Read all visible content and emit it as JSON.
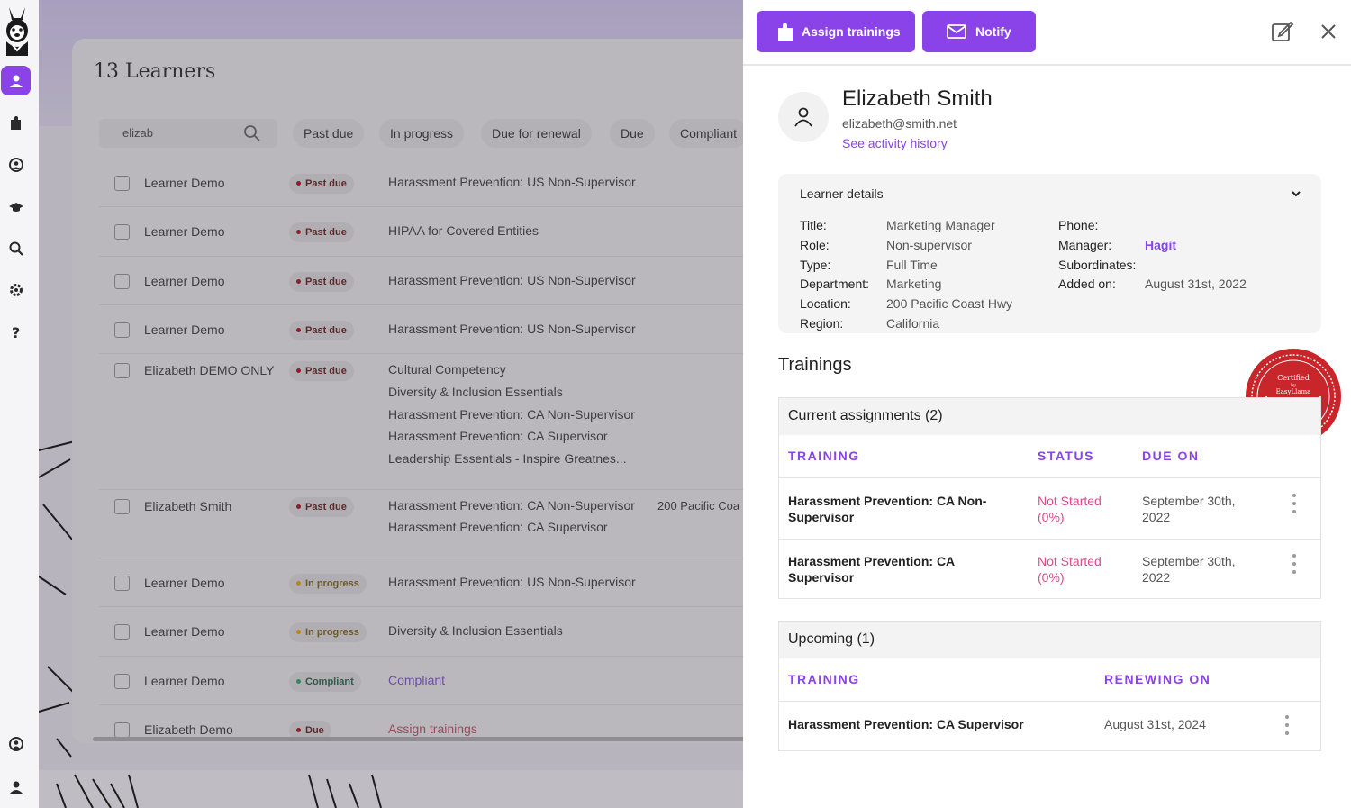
{
  "sidebar": {
    "items": [
      {
        "icon": "user-icon",
        "active": true
      },
      {
        "icon": "puzzle-icon"
      },
      {
        "icon": "face-icon"
      },
      {
        "icon": "graduation-cap-icon"
      },
      {
        "icon": "search-icon"
      },
      {
        "icon": "gear-icon"
      },
      {
        "icon": "help-icon"
      },
      {
        "icon": "face-icon"
      },
      {
        "icon": "user-icon"
      }
    ]
  },
  "learners": {
    "title": "13 Learners",
    "search_value": "elizab",
    "filters": [
      "Past due",
      "In progress",
      "Due for renewal",
      "Due",
      "Compliant"
    ],
    "rows": [
      {
        "name": "Learner Demo",
        "status": "Past due",
        "courses": [
          "Harassment Prevention: US Non-Supervisor"
        ]
      },
      {
        "name": "Learner Demo",
        "status": "Past due",
        "courses": [
          "HIPAA for Covered Entities"
        ]
      },
      {
        "name": "Learner Demo",
        "status": "Past due",
        "courses": [
          "Harassment Prevention: US Non-Supervisor"
        ]
      },
      {
        "name": "Learner Demo",
        "status": "Past due",
        "courses": [
          "Harassment Prevention: US Non-Supervisor"
        ]
      },
      {
        "name": "Elizabeth DEMO ONLY",
        "status": "Past due",
        "courses": [
          "Cultural Competency",
          "Diversity & Inclusion Essentials",
          "Harassment Prevention: CA Non-Supervisor",
          "Harassment Prevention: CA Supervisor",
          "Leadership Essentials - Inspire Greatnes..."
        ]
      },
      {
        "name": "Elizabeth Smith",
        "status": "Past due",
        "courses": [
          "Harassment Prevention: CA Non-Supervisor",
          "Harassment Prevention: CA Supervisor"
        ],
        "location": "200 Pacific Coa"
      },
      {
        "name": "Learner Demo",
        "status": "In progress",
        "courses": [
          "Harassment Prevention: US Non-Supervisor"
        ]
      },
      {
        "name": "Learner Demo",
        "status": "In progress",
        "courses": [
          "Diversity & Inclusion Essentials"
        ]
      },
      {
        "name": "Learner Demo",
        "status": "Compliant",
        "courses": [
          "Compliant"
        ]
      },
      {
        "name": "Elizabeth Demo",
        "status": "Due",
        "courses": [
          "Assign trainings"
        ]
      }
    ]
  },
  "panel": {
    "assign_label": "Assign trainings",
    "notify_label": "Notify",
    "user": {
      "name": "Elizabeth Smith",
      "email": "elizabeth@smith.net",
      "activity_link": "See activity history"
    },
    "details": {
      "header": "Learner details",
      "left": [
        {
          "label": "Title:",
          "value": "Marketing Manager"
        },
        {
          "label": "Role:",
          "value": "Non-supervisor"
        },
        {
          "label": "Type:",
          "value": "Full Time"
        },
        {
          "label": "Department:",
          "value": "Marketing"
        },
        {
          "label": "Location:",
          "value": "200 Pacific Coast Hwy"
        },
        {
          "label": "Region:",
          "value": "California"
        }
      ],
      "right": [
        {
          "label": "Phone:",
          "value": ""
        },
        {
          "label": "Manager:",
          "value": "Hagit"
        },
        {
          "label": "Subordinates:",
          "value": ""
        },
        {
          "label": "Added on:",
          "value": "August 31st, 2022"
        }
      ]
    },
    "trainings_title": "Trainings",
    "seal_text": [
      "Certified",
      "by",
      "EasyLlama"
    ],
    "current": {
      "header": "Current assignments (2)",
      "columns": [
        "TRAINING",
        "STATUS",
        "DUE ON"
      ],
      "rows": [
        {
          "training": "Harassment Prevention: CA Non-Supervisor",
          "status": "Not Started (0%)",
          "due": "September 30th, 2022"
        },
        {
          "training": "Harassment Prevention: CA Supervisor",
          "status": "Not Started (0%)",
          "due": "September 30th, 2022"
        }
      ]
    },
    "upcoming": {
      "header": "Upcoming (1)",
      "columns": [
        "TRAINING",
        "RENEWING ON"
      ],
      "rows": [
        {
          "training": "Harassment Prevention: CA Supervisor",
          "renewing": "August 31st, 2024"
        }
      ]
    }
  }
}
